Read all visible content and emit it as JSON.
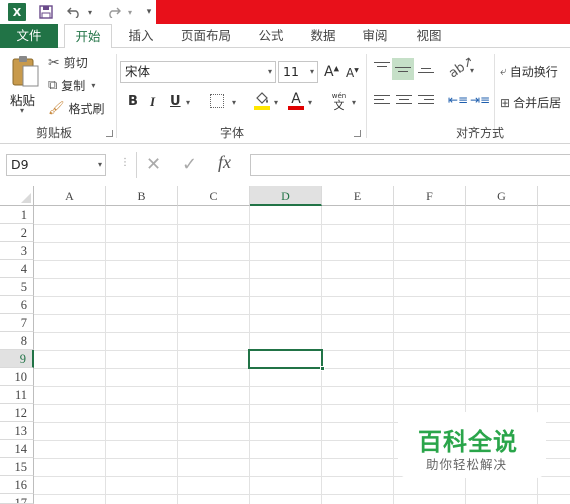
{
  "qat": {
    "excel_icon": "excel-logo",
    "save_icon": "save-icon",
    "undo_icon": "undo-icon",
    "redo_icon": "redo-icon"
  },
  "tabs": [
    {
      "label": "文件"
    },
    {
      "label": "开始"
    },
    {
      "label": "插入"
    },
    {
      "label": "页面布局"
    },
    {
      "label": "公式"
    },
    {
      "label": "数据"
    },
    {
      "label": "审阅"
    },
    {
      "label": "视图"
    }
  ],
  "clipboard": {
    "paste": "粘贴",
    "cut": "剪切",
    "copy": "复制",
    "format_painter": "格式刷",
    "group": "剪贴板"
  },
  "font": {
    "name": "宋体",
    "size": "11",
    "bold": "B",
    "italic": "I",
    "underline": "U",
    "group": "字体",
    "grow": "A",
    "shrink": "A",
    "color_a": "A",
    "phonetic": "wén"
  },
  "alignment": {
    "wrap": "自动换行",
    "merge": "合并后居",
    "group": "对齐方式"
  },
  "formula_bar": {
    "name_box": "D9",
    "cancel": "✕",
    "enter": "✓",
    "fx": "fx",
    "value": ""
  },
  "sheet": {
    "columns": [
      "A",
      "B",
      "C",
      "D",
      "E",
      "F",
      "G"
    ],
    "rows": [
      "1",
      "2",
      "3",
      "4",
      "5",
      "6",
      "7",
      "8",
      "9",
      "10",
      "11",
      "12",
      "13",
      "14",
      "15",
      "16",
      "17"
    ],
    "selected_cell": "D9"
  },
  "watermark": {
    "title": "百科全说",
    "subtitle": "助你轻松解决"
  },
  "colors": {
    "excel_green": "#217346",
    "redbar": "#e8101a",
    "highlight": "#ffe600",
    "font_red": "#e00000"
  }
}
